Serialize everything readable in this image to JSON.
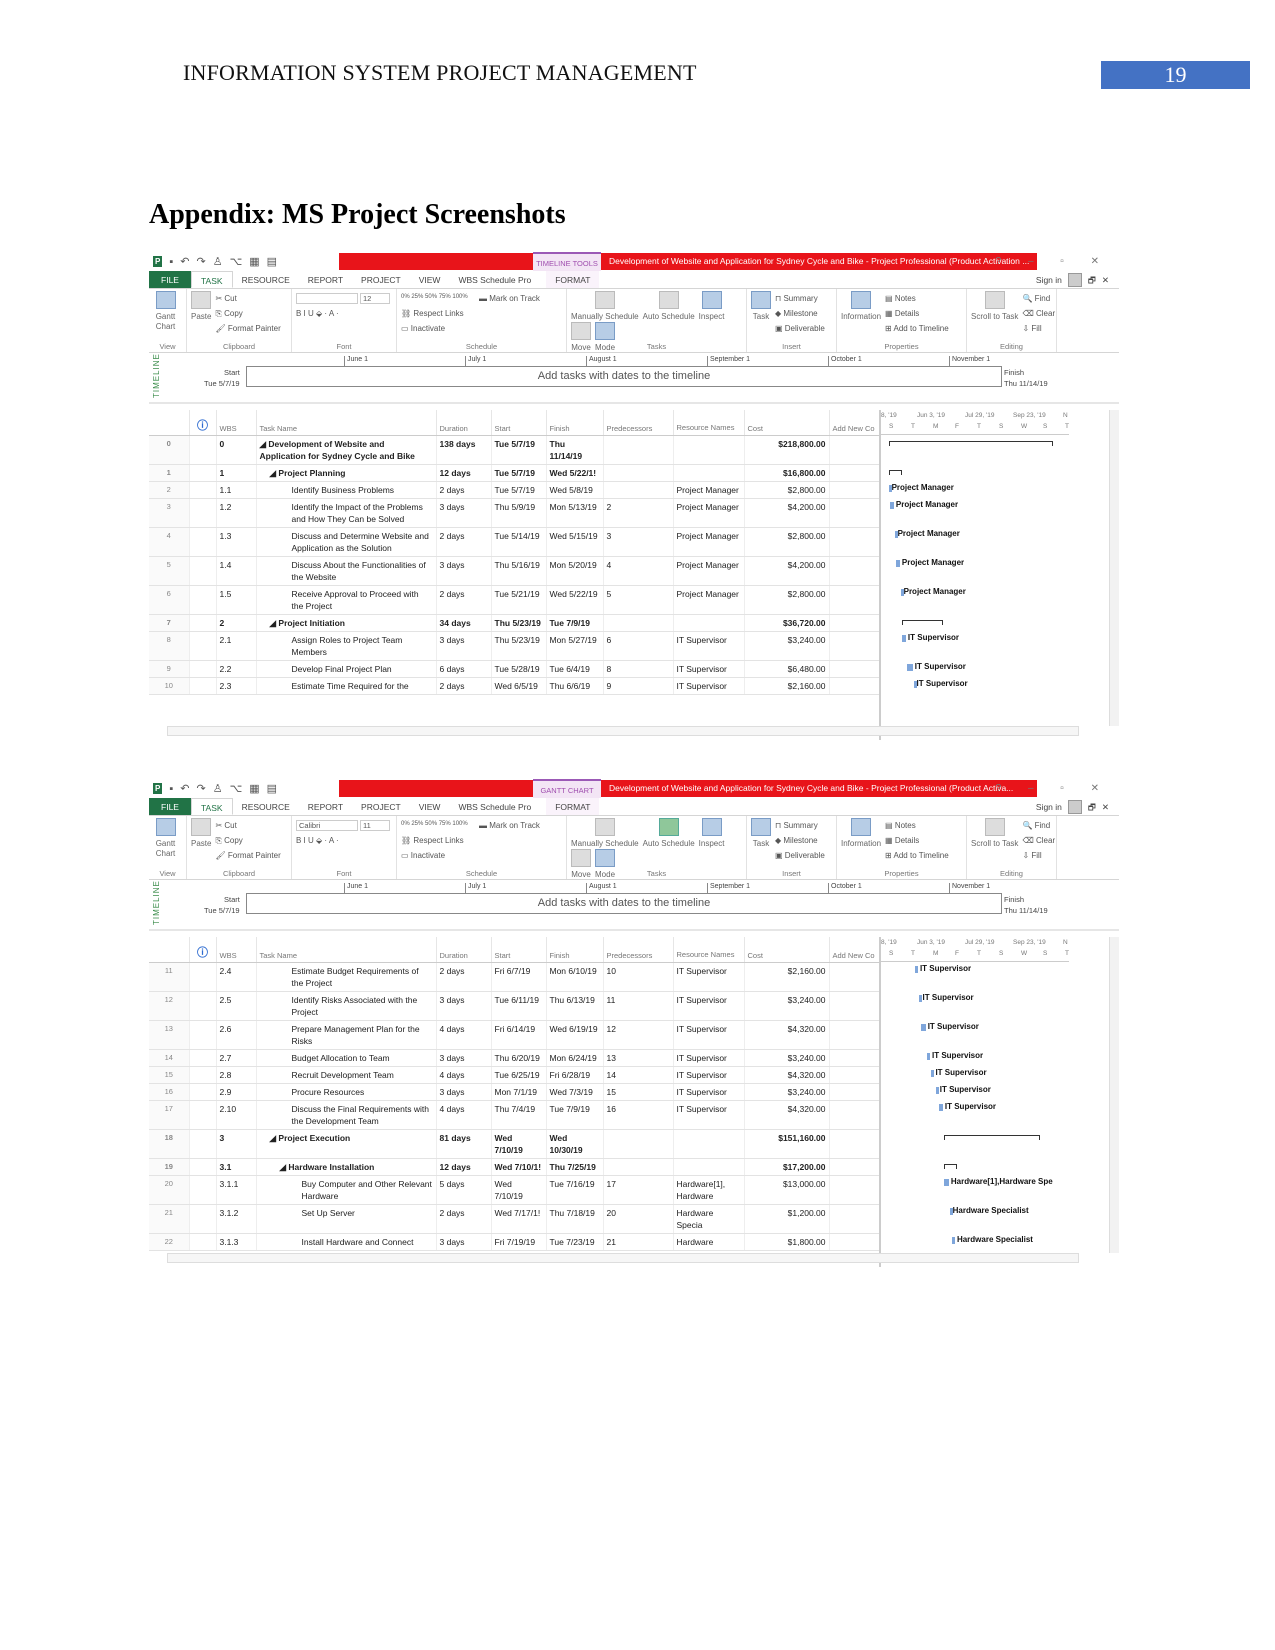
{
  "header": {
    "title": "INFORMATION SYSTEM PROJECT MANAGEMENT",
    "page_number": "19"
  },
  "heading": "Appendix: MS Project Screenshots",
  "colors": {
    "title_bar": "#e8141a",
    "file_tab": "#217346",
    "page_badge": "#4472c4",
    "task_bar": "#7fa6db"
  },
  "screenshots": [
    {
      "context_tab": "TIMELINE TOOLS",
      "window_title": "Development of Website and Application for Sydney Cycle and Bike -  Project Professional (Product Activation ...",
      "tabs": [
        "FILE",
        "TASK",
        "RESOURCE",
        "REPORT",
        "PROJECT",
        "VIEW",
        "WBS Schedule Pro",
        "FORMAT"
      ],
      "sign_in": "Sign in",
      "font_name": "",
      "font_size": "12",
      "auto_schedule_active": false,
      "timeline": {
        "label": "TIMELINE",
        "months": [
          "June 1",
          "July 1",
          "August 1",
          "September 1",
          "October 1",
          "November 1"
        ],
        "start_label": "Start",
        "start": "Tue 5/7/19",
        "finish_label": "Finish",
        "finish": "Thu 11/14/19",
        "placeholder": "Add tasks with dates to the timeline"
      },
      "view_label": "GANTT CHART",
      "columns": [
        "WBS",
        "Task Name",
        "Duration",
        "Start",
        "Finish",
        "Predecessors",
        "Resource Names",
        "Cost",
        "Add New Co"
      ],
      "gantt_header": [
        "8, '19",
        "Jun 3, '19",
        "Jul 29, '19",
        "Sep 23, '19",
        "N"
      ],
      "gantt_days": [
        "S",
        "T",
        "M",
        "F",
        "T",
        "S",
        "W",
        "S",
        "T"
      ],
      "rows": [
        {
          "id": "0",
          "wbs": "0",
          "name": "Development of Website and Application for Sydney Cycle and Bike",
          "duration": "138 days",
          "start": "Tue 5/7/19",
          "finish": "Thu 11/14/19",
          "pred": "",
          "resource": "",
          "cost": "$218,800.00",
          "level": 0,
          "summary": true
        },
        {
          "id": "1",
          "wbs": "1",
          "name": "Project Planning",
          "duration": "12 days",
          "start": "Tue 5/7/19",
          "finish": "Wed 5/22/1!",
          "pred": "",
          "resource": "",
          "cost": "$16,800.00",
          "level": 1,
          "summary": true
        },
        {
          "id": "2",
          "wbs": "1.1",
          "name": "Identify Business Problems",
          "duration": "2 days",
          "start": "Tue 5/7/19",
          "finish": "Wed 5/8/19",
          "pred": "",
          "resource": "Project Manager",
          "cost": "$2,800.00",
          "level": 2,
          "bar": "Project Manager"
        },
        {
          "id": "3",
          "wbs": "1.2",
          "name": "Identify the Impact of the Problems and How They Can be Solved",
          "duration": "3 days",
          "start": "Thu 5/9/19",
          "finish": "Mon 5/13/19",
          "pred": "2",
          "resource": "Project Manager",
          "cost": "$4,200.00",
          "level": 2,
          "bar": "Project Manager"
        },
        {
          "id": "4",
          "wbs": "1.3",
          "name": "Discuss and Determine Website and Application as the Solution",
          "duration": "2 days",
          "start": "Tue 5/14/19",
          "finish": "Wed 5/15/19",
          "pred": "3",
          "resource": "Project Manager",
          "cost": "$2,800.00",
          "level": 2,
          "bar": "Project Manager"
        },
        {
          "id": "5",
          "wbs": "1.4",
          "name": "Discuss About the Functionalities of the Website",
          "duration": "3 days",
          "start": "Thu 5/16/19",
          "finish": "Mon 5/20/19",
          "pred": "4",
          "resource": "Project Manager",
          "cost": "$4,200.00",
          "level": 2,
          "bar": "Project Manager"
        },
        {
          "id": "6",
          "wbs": "1.5",
          "name": "Receive Approval to Proceed with the Project",
          "duration": "2 days",
          "start": "Tue 5/21/19",
          "finish": "Wed 5/22/19",
          "pred": "5",
          "resource": "Project Manager",
          "cost": "$2,800.00",
          "level": 2,
          "bar": "Project Manager"
        },
        {
          "id": "7",
          "wbs": "2",
          "name": "Project Initiation",
          "duration": "34 days",
          "start": "Thu 5/23/19",
          "finish": "Tue 7/9/19",
          "pred": "",
          "resource": "",
          "cost": "$36,720.00",
          "level": 1,
          "summary": true
        },
        {
          "id": "8",
          "wbs": "2.1",
          "name": "Assign Roles to Project Team Members",
          "duration": "3 days",
          "start": "Thu 5/23/19",
          "finish": "Mon 5/27/19",
          "pred": "6",
          "resource": "IT Supervisor",
          "cost": "$3,240.00",
          "level": 2,
          "bar": "IT Supervisor"
        },
        {
          "id": "9",
          "wbs": "2.2",
          "name": "Develop Final Project Plan",
          "duration": "6 days",
          "start": "Tue 5/28/19",
          "finish": "Tue 6/4/19",
          "pred": "8",
          "resource": "IT Supervisor",
          "cost": "$6,480.00",
          "level": 2,
          "bar": "IT Supervisor"
        },
        {
          "id": "10",
          "wbs": "2.3",
          "name": "Estimate Time Required for the",
          "duration": "2 days",
          "start": "Wed 6/5/19",
          "finish": "Thu 6/6/19",
          "pred": "9",
          "resource": "IT Supervisor",
          "cost": "$2,160.00",
          "level": 2,
          "bar": "IT Supervisor"
        }
      ]
    },
    {
      "context_tab": "GANTT CHART TOOLS",
      "window_title": "Development of Website and Application for Sydney Cycle and Bike -  Project Professional (Product Activa...",
      "tabs": [
        "FILE",
        "TASK",
        "RESOURCE",
        "REPORT",
        "PROJECT",
        "VIEW",
        "WBS Schedule Pro",
        "FORMAT"
      ],
      "sign_in": "Sign in",
      "font_name": "Calibri",
      "font_size": "11",
      "auto_schedule_active": true,
      "timeline": {
        "label": "TIMELINE",
        "months": [
          "June 1",
          "July 1",
          "August 1",
          "September 1",
          "October 1",
          "November 1"
        ],
        "start_label": "Start",
        "start": "Tue 5/7/19",
        "finish_label": "Finish",
        "finish": "Thu 11/14/19",
        "placeholder": "Add tasks with dates to the timeline"
      },
      "view_label": "GANTT CHART",
      "columns": [
        "WBS",
        "Task Name",
        "Duration",
        "Start",
        "Finish",
        "Predecessors",
        "Resource Names",
        "Cost",
        "Add New Co"
      ],
      "gantt_header": [
        "8, '19",
        "Jun 3, '19",
        "Jul 29, '19",
        "Sep 23, '19",
        "N"
      ],
      "gantt_days": [
        "S",
        "T",
        "M",
        "F",
        "T",
        "S",
        "W",
        "S",
        "T"
      ],
      "rows": [
        {
          "id": "11",
          "wbs": "2.4",
          "name": "Estimate Budget Requirements of the Project",
          "duration": "2 days",
          "start": "Fri 6/7/19",
          "finish": "Mon 6/10/19",
          "pred": "10",
          "resource": "IT Supervisor",
          "cost": "$2,160.00",
          "level": 2,
          "bar": "IT Supervisor"
        },
        {
          "id": "12",
          "wbs": "2.5",
          "name": "Identify Risks Associated with the Project",
          "duration": "3 days",
          "start": "Tue 6/11/19",
          "finish": "Thu 6/13/19",
          "pred": "11",
          "resource": "IT Supervisor",
          "cost": "$3,240.00",
          "level": 2,
          "bar": "IT Supervisor"
        },
        {
          "id": "13",
          "wbs": "2.6",
          "name": "Prepare Management Plan for the Risks",
          "duration": "4 days",
          "start": "Fri 6/14/19",
          "finish": "Wed 6/19/19",
          "pred": "12",
          "resource": "IT Supervisor",
          "cost": "$4,320.00",
          "level": 2,
          "bar": "IT Supervisor"
        },
        {
          "id": "14",
          "wbs": "2.7",
          "name": "Budget Allocation to Team",
          "duration": "3 days",
          "start": "Thu 6/20/19",
          "finish": "Mon 6/24/19",
          "pred": "13",
          "resource": "IT Supervisor",
          "cost": "$3,240.00",
          "level": 2,
          "bar": "IT Supervisor"
        },
        {
          "id": "15",
          "wbs": "2.8",
          "name": "Recruit Development Team",
          "duration": "4 days",
          "start": "Tue 6/25/19",
          "finish": "Fri 6/28/19",
          "pred": "14",
          "resource": "IT Supervisor",
          "cost": "$4,320.00",
          "level": 2,
          "bar": "IT Supervisor"
        },
        {
          "id": "16",
          "wbs": "2.9",
          "name": "Procure Resources",
          "duration": "3 days",
          "start": "Mon 7/1/19",
          "finish": "Wed 7/3/19",
          "pred": "15",
          "resource": "IT Supervisor",
          "cost": "$3,240.00",
          "level": 2,
          "bar": "IT Supervisor"
        },
        {
          "id": "17",
          "wbs": "2.10",
          "name": "Discuss the Final Requirements with the Development Team",
          "duration": "4 days",
          "start": "Thu 7/4/19",
          "finish": "Tue 7/9/19",
          "pred": "16",
          "resource": "IT Supervisor",
          "cost": "$4,320.00",
          "level": 2,
          "bar": "IT Supervisor"
        },
        {
          "id": "18",
          "wbs": "3",
          "name": "Project Execution",
          "duration": "81 days",
          "start": "Wed 7/10/19",
          "finish": "Wed 10/30/19",
          "pred": "",
          "resource": "",
          "cost": "$151,160.00",
          "level": 1,
          "summary": true
        },
        {
          "id": "19",
          "wbs": "3.1",
          "name": "Hardware Installation",
          "duration": "12 days",
          "start": "Wed 7/10/1!",
          "finish": "Thu 7/25/19",
          "pred": "",
          "resource": "",
          "cost": "$17,200.00",
          "level": 2,
          "summary": true
        },
        {
          "id": "20",
          "wbs": "3.1.1",
          "name": "Buy Computer and Other Relevant Hardware",
          "duration": "5 days",
          "start": "Wed 7/10/19",
          "finish": "Tue 7/16/19",
          "pred": "17",
          "resource": "Hardware[1], Hardware",
          "cost": "$13,000.00",
          "level": 3,
          "bar": "Hardware[1],Hardware Spe"
        },
        {
          "id": "21",
          "wbs": "3.1.2",
          "name": "Set Up Server",
          "duration": "2 days",
          "start": "Wed 7/17/1!",
          "finish": "Thu 7/18/19",
          "pred": "20",
          "resource": "Hardware Specia",
          "cost": "$1,200.00",
          "level": 3,
          "bar": "Hardware Specialist"
        },
        {
          "id": "22",
          "wbs": "3.1.3",
          "name": "Install Hardware and Connect",
          "duration": "3 days",
          "start": "Fri 7/19/19",
          "finish": "Tue 7/23/19",
          "pred": "21",
          "resource": "Hardware",
          "cost": "$1,800.00",
          "level": 3,
          "bar": "Hardware Specialist"
        }
      ]
    }
  ],
  "ribbon": {
    "gantt_chart": "Gantt Chart",
    "view": "View",
    "paste": "Paste",
    "cut": "Cut",
    "copy": "Copy",
    "format_painter": "Format Painter",
    "clipboard": "Clipboard",
    "font": "Font",
    "pct": "0% 25% 50% 75% 100%",
    "mark_on_track": "Mark on Track",
    "respect_links": "Respect Links",
    "inactivate": "Inactivate",
    "schedule": "Schedule",
    "manually": "Manually Schedule",
    "auto": "Auto Schedule",
    "inspect": "Inspect",
    "move": "Move",
    "mode": "Mode",
    "tasks": "Tasks",
    "task": "Task",
    "summary": "Summary",
    "milestone": "Milestone",
    "deliverable": "Deliverable",
    "insert": "Insert",
    "information": "Information",
    "notes": "Notes",
    "details": "Details",
    "add_to_timeline": "Add to Timeline",
    "properties": "Properties",
    "scroll": "Scroll to Task",
    "find": "Find",
    "clear": "Clear",
    "fill": "Fill",
    "editing": "Editing"
  }
}
